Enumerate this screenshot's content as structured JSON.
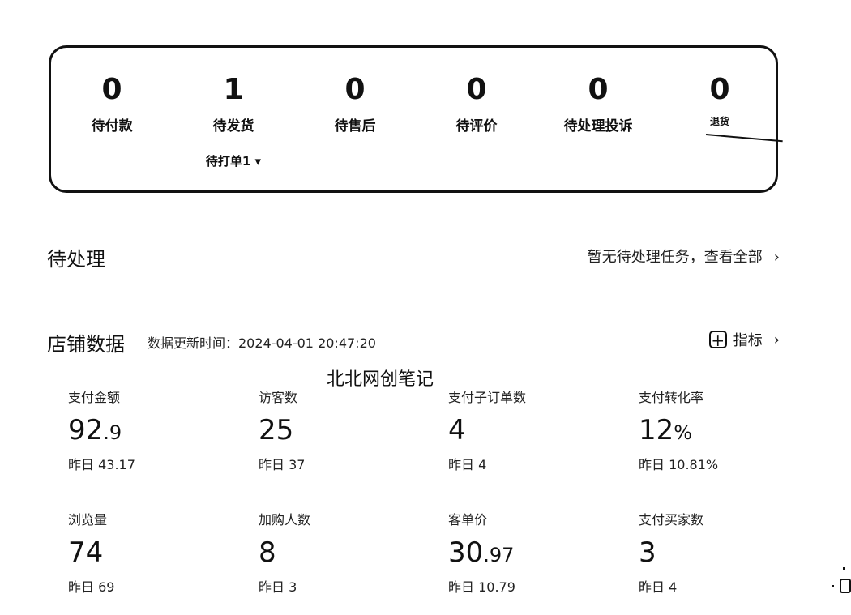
{
  "order_status": [
    {
      "count": "0",
      "label": "待付款"
    },
    {
      "count": "1",
      "label": "待发货",
      "sub": "待打单1 ▾"
    },
    {
      "count": "0",
      "label": "待售后"
    },
    {
      "count": "0",
      "label": "待评价"
    },
    {
      "count": "0",
      "label": "待处理投诉"
    },
    {
      "count": "0",
      "label": "退货"
    }
  ],
  "pending": {
    "title": "待处理",
    "link_text": "暂无待处理任务，查看全部",
    "chevron": "›"
  },
  "store": {
    "title": "店铺数据",
    "update_label": "数据更新时间：2024-04-01 20:47:20",
    "metric_button": "指标",
    "plus_icon": "+",
    "chevron": "›"
  },
  "watermark": "北北网创笔记",
  "metrics": [
    {
      "label": "支付金额",
      "int": "92",
      "dec": ".9",
      "prev": "昨日 43.17"
    },
    {
      "label": "访客数",
      "int": "25",
      "dec": "",
      "prev": "昨日 37"
    },
    {
      "label": "支付子订单数",
      "int": "4",
      "dec": "",
      "prev": "昨日 4"
    },
    {
      "label": "支付转化率",
      "int": "12",
      "dec": "%",
      "prev": "昨日 10.81%"
    },
    {
      "label": "浏览量",
      "int": "74",
      "dec": "",
      "prev": "昨日 69"
    },
    {
      "label": "加购人数",
      "int": "8",
      "dec": "",
      "prev": "昨日 3"
    },
    {
      "label": "客单价",
      "int": "30",
      "dec": ".97",
      "prev": "昨日 10.79"
    },
    {
      "label": "支付买家数",
      "int": "3",
      "dec": "",
      "prev": "昨日 4"
    }
  ]
}
